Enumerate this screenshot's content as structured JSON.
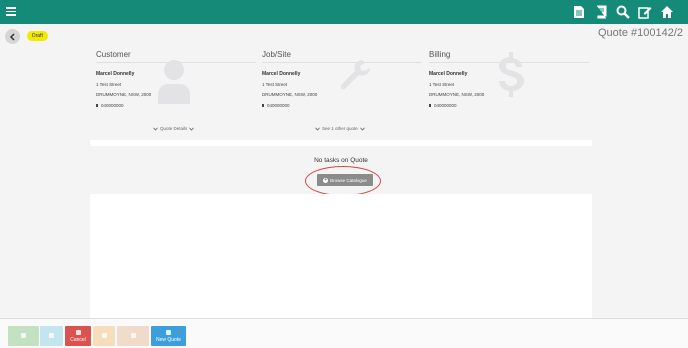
{
  "quote_header": {
    "status": "Draft",
    "title": "Quote #100142/2"
  },
  "panels": [
    {
      "heading": "Customer",
      "name": "Marcel Donnelly",
      "street": "1 Test Street",
      "suburb": "DRUMMOYNE, NSW, 2000",
      "phone": "040000000",
      "bg_icon": "person-icon"
    },
    {
      "heading": "Job/Site",
      "name": "Marcel Donnelly",
      "street": "1 Test Street",
      "suburb": "DRUMMOYNE, NSW, 2000",
      "phone": "040000000",
      "bg_icon": "wrench-icon"
    },
    {
      "heading": "Billing",
      "name": "Marcel Donnelly",
      "street": "1 Test Street",
      "suburb": "DRUMMOYNE, NSW, 2000",
      "phone": "040000000",
      "bg_icon": "dollar-icon"
    }
  ],
  "links": {
    "quote_details": "Quote Details",
    "other_quote": "See 1 other quote"
  },
  "tasks": {
    "empty_text": "No tasks on Quote",
    "browse_label": "Browse Catalogue"
  },
  "actions": [
    {
      "label": "",
      "color": "#5cb85c",
      "enabled": false
    },
    {
      "label": "",
      "color": "#5bc0de",
      "enabled": false
    },
    {
      "label": "Cancel",
      "color": "#d9534f",
      "enabled": true
    },
    {
      "label": "",
      "color": "#f0ad4e",
      "enabled": false
    },
    {
      "label": "",
      "color": "#e0a070",
      "enabled": false
    },
    {
      "label": "New Quote",
      "color": "#3c9fdc",
      "enabled": true
    }
  ],
  "colors": {
    "header": "#168a78",
    "badge": "#f1e900",
    "highlight": "#d64545"
  }
}
